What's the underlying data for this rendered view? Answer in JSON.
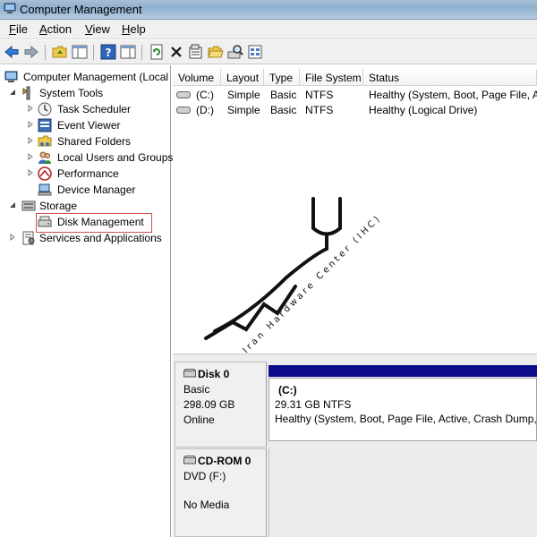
{
  "window": {
    "title": "Computer Management"
  },
  "menu": [
    {
      "label_pre": "",
      "accel": "F",
      "label_post": "ile"
    },
    {
      "label_pre": "",
      "accel": "A",
      "label_post": "ction"
    },
    {
      "label_pre": "",
      "accel": "V",
      "label_post": "iew"
    },
    {
      "label_pre": "",
      "accel": "H",
      "label_post": "elp"
    }
  ],
  "toolbar": {
    "buttons": [
      "back-arrow-icon",
      "forward-arrow-icon",
      "up-folder-icon",
      "show-hide-tree-icon",
      "help-icon",
      "action-pane-icon",
      "refresh-icon",
      "delete-icon",
      "properties-icon",
      "open-folder-icon",
      "search-disk-icon",
      "export-list-icon"
    ]
  },
  "tree": {
    "root": "Computer Management (Local",
    "system_tools": "System Tools",
    "task_scheduler": "Task Scheduler",
    "event_viewer": "Event Viewer",
    "shared_folders": "Shared Folders",
    "local_users": "Local Users and Groups",
    "performance": "Performance",
    "device_manager": "Device Manager",
    "storage": "Storage",
    "disk_management": "Disk Management",
    "services": "Services and Applications"
  },
  "volumes": {
    "columns": [
      "Volume",
      "Layout",
      "Type",
      "File System",
      "Status"
    ],
    "rows": [
      {
        "volume": "(C:)",
        "layout": "Simple",
        "type": "Basic",
        "fs": "NTFS",
        "status": "Healthy (System, Boot, Page File, Ac"
      },
      {
        "volume": "(D:)",
        "layout": "Simple",
        "type": "Basic",
        "fs": "NTFS",
        "status": "Healthy (Logical Drive)"
      }
    ]
  },
  "watermark": {
    "text": "Iran Hardware Center (IHC)"
  },
  "disks": [
    {
      "name": "Disk 0",
      "kind": "Basic",
      "size": "298.09 GB",
      "state": "Online",
      "partition": {
        "name": "(C:)",
        "size_fs": "29.31 GB NTFS",
        "status": "Healthy (System, Boot, Page File, Active, Crash Dump, P"
      }
    },
    {
      "name": "CD-ROM 0",
      "kind": "DVD (F:)",
      "size": "",
      "state": "No Media"
    }
  ],
  "colors": {
    "partition_bar": "#0b0b8c",
    "selection_border": "#d05050",
    "titlebar": "#a9bfd6"
  }
}
